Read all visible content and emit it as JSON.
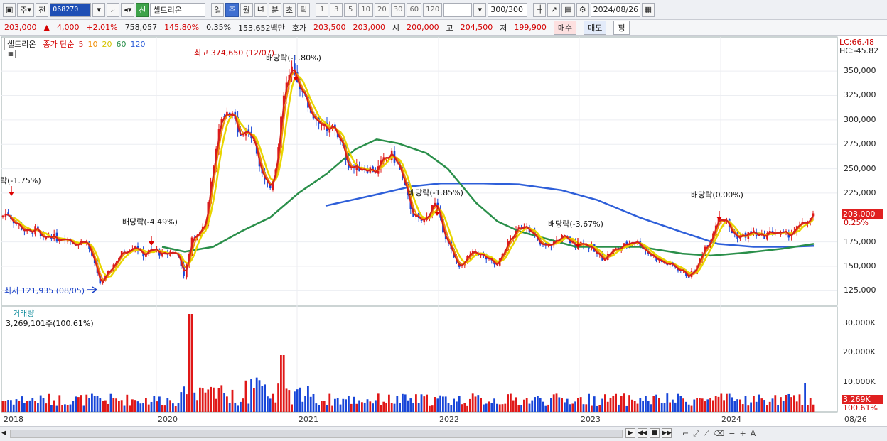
{
  "toolbar": {
    "period_type": "주",
    "prev_label": "전",
    "stock_code": "068270",
    "badge": "신",
    "stock_name": "셀트리온",
    "periods": [
      "일",
      "주",
      "월",
      "년",
      "분",
      "초",
      "틱"
    ],
    "selected_period": "주",
    "counts": [
      "1",
      "3",
      "5",
      "10",
      "20",
      "30",
      "60",
      "120"
    ],
    "view_count": "300",
    "view_total": "/300",
    "date": "2024/08/26"
  },
  "quote": {
    "price": "203,000",
    "change_arrow": "▲",
    "change": "4,000",
    "change_pct": "+2.01%",
    "volume": "758,057",
    "vol_ratio": "145.80%",
    "turnover": "0.35%",
    "amount": "153,652백만",
    "bid_label": "호가",
    "ask": "203,500",
    "bid": "203,000",
    "open_label": "시",
    "open": "200,000",
    "high_label": "고",
    "high": "204,500",
    "low_label": "저",
    "low": "199,900",
    "buy": "매수",
    "sell": "매도",
    "avg": "평"
  },
  "legend": {
    "stock": "셀트리온",
    "type": "종가 단순",
    "ma": [
      {
        "label": "5",
        "color": "#d42020"
      },
      {
        "label": "10",
        "color": "#f0900a"
      },
      {
        "label": "20",
        "color": "#e8d600"
      },
      {
        "label": "60",
        "color": "#2a8f4a"
      },
      {
        "label": "120",
        "color": "#2e5fd9"
      }
    ]
  },
  "annotations": {
    "high": "최고 374,650 (12/07)",
    "low": "최저 121,935 (08/05)",
    "div1": "락(-1.75%)",
    "div2": "배당락(-4.49%)",
    "div3": "배당락(-1.80%)",
    "div4": "배당락(-1.85%)",
    "div5": "배당락(-3.67%)",
    "div6": "배당락(0.00%)"
  },
  "right_info": {
    "lc": "LC:66.48",
    "hc": "HC:-45.82",
    "price_box": "203,000",
    "pct": "0.25%",
    "vol_box": "3,269K",
    "vol_pct": "100.61%"
  },
  "price_axis": [
    "350,000",
    "325,000",
    "300,000",
    "275,000",
    "250,000",
    "225,000",
    "175,000",
    "150,000",
    "125,000"
  ],
  "volume": {
    "label": "거래량",
    "value": "3,269,101주(100.61%)",
    "axis": [
      "30,000K",
      "20,000K",
      "10,000K"
    ]
  },
  "years": [
    "2018",
    "2020",
    "2021",
    "2022",
    "2023",
    "2024"
  ],
  "last_date": "08/26",
  "chart_data": {
    "type": "candlestick-weekly",
    "ylim": [
      110000,
      385000
    ],
    "close_path": [
      [
        0,
        200000
      ],
      [
        10,
        205000
      ],
      [
        20,
        196000
      ],
      [
        30,
        190000
      ],
      [
        40,
        184000
      ],
      [
        50,
        188000
      ],
      [
        60,
        176000
      ],
      [
        70,
        183000
      ],
      [
        80,
        178000
      ],
      [
        90,
        181000
      ],
      [
        100,
        176000
      ],
      [
        110,
        173000
      ],
      [
        120,
        178000
      ],
      [
        130,
        160000
      ],
      [
        140,
        132000
      ],
      [
        150,
        140000
      ],
      [
        160,
        152000
      ],
      [
        170,
        162000
      ],
      [
        180,
        168000
      ],
      [
        190,
        172000
      ],
      [
        200,
        162000
      ],
      [
        210,
        165000
      ],
      [
        220,
        167000
      ],
      [
        230,
        160000
      ],
      [
        240,
        165000
      ],
      [
        250,
        163000
      ],
      [
        260,
        140000
      ],
      [
        270,
        178000
      ],
      [
        280,
        185000
      ],
      [
        290,
        196000
      ],
      [
        300,
        255000
      ],
      [
        310,
        296000
      ],
      [
        320,
        305000
      ],
      [
        330,
        300000
      ],
      [
        340,
        285000
      ],
      [
        350,
        290000
      ],
      [
        360,
        270000
      ],
      [
        370,
        245000
      ],
      [
        380,
        230000
      ],
      [
        390,
        260000
      ],
      [
        400,
        330000
      ],
      [
        410,
        350000
      ],
      [
        420,
        340000
      ],
      [
        430,
        320000
      ],
      [
        440,
        305000
      ],
      [
        450,
        300000
      ],
      [
        460,
        285000
      ],
      [
        470,
        295000
      ],
      [
        480,
        275000
      ],
      [
        490,
        255000
      ],
      [
        500,
        250000
      ],
      [
        510,
        252000
      ],
      [
        520,
        250000
      ],
      [
        530,
        248000
      ],
      [
        540,
        258000
      ],
      [
        550,
        265000
      ],
      [
        560,
        255000
      ],
      [
        570,
        230000
      ],
      [
        580,
        205000
      ],
      [
        590,
        196000
      ],
      [
        600,
        198000
      ],
      [
        610,
        218000
      ],
      [
        620,
        195000
      ],
      [
        630,
        175000
      ],
      [
        640,
        155000
      ],
      [
        650,
        150000
      ],
      [
        660,
        160000
      ],
      [
        670,
        165000
      ],
      [
        680,
        160000
      ],
      [
        690,
        155000
      ],
      [
        700,
        150000
      ],
      [
        710,
        168000
      ],
      [
        720,
        180000
      ],
      [
        730,
        188000
      ],
      [
        740,
        195000
      ],
      [
        750,
        182000
      ],
      [
        760,
        172000
      ],
      [
        770,
        170000
      ],
      [
        780,
        175000
      ],
      [
        790,
        180000
      ],
      [
        800,
        176000
      ],
      [
        810,
        172000
      ],
      [
        820,
        175000
      ],
      [
        830,
        170000
      ],
      [
        840,
        162000
      ],
      [
        850,
        158000
      ],
      [
        860,
        165000
      ],
      [
        870,
        168000
      ],
      [
        880,
        172000
      ],
      [
        890,
        176000
      ],
      [
        900,
        174000
      ],
      [
        910,
        165000
      ],
      [
        920,
        160000
      ],
      [
        930,
        155000
      ],
      [
        940,
        152000
      ],
      [
        950,
        150000
      ],
      [
        960,
        145000
      ],
      [
        970,
        140000
      ],
      [
        980,
        148000
      ],
      [
        990,
        168000
      ],
      [
        1000,
        178000
      ],
      [
        1010,
        200000
      ],
      [
        1020,
        198000
      ],
      [
        1030,
        185000
      ],
      [
        1040,
        180000
      ],
      [
        1050,
        182000
      ],
      [
        1060,
        185000
      ],
      [
        1070,
        180000
      ],
      [
        1080,
        183000
      ],
      [
        1090,
        186000
      ],
      [
        1100,
        182000
      ],
      [
        1110,
        183000
      ],
      [
        1120,
        188000
      ],
      [
        1130,
        193000
      ],
      [
        1140,
        199000
      ],
      [
        1145,
        203000
      ]
    ],
    "ma120_points": [
      [
        458,
        212000
      ],
      [
        520,
        222000
      ],
      [
        580,
        232000
      ],
      [
        620,
        235000
      ],
      [
        680,
        235000
      ],
      [
        730,
        234000
      ],
      [
        790,
        228000
      ],
      [
        840,
        218000
      ],
      [
        900,
        200000
      ],
      [
        960,
        185000
      ],
      [
        1010,
        173000
      ],
      [
        1060,
        170000
      ],
      [
        1110,
        170000
      ],
      [
        1145,
        171000
      ]
    ],
    "ma60_points": [
      [
        228,
        170000
      ],
      [
        260,
        165000
      ],
      [
        300,
        170000
      ],
      [
        340,
        186000
      ],
      [
        380,
        200000
      ],
      [
        420,
        225000
      ],
      [
        460,
        245000
      ],
      [
        500,
        270000
      ],
      [
        530,
        280000
      ],
      [
        560,
        276000
      ],
      [
        600,
        266000
      ],
      [
        630,
        250000
      ],
      [
        670,
        215000
      ],
      [
        700,
        196000
      ],
      [
        730,
        186000
      ],
      [
        770,
        178000
      ],
      [
        810,
        170000
      ],
      [
        850,
        170000
      ],
      [
        900,
        170000
      ],
      [
        960,
        163000
      ],
      [
        1000,
        161000
      ],
      [
        1050,
        164000
      ],
      [
        1100,
        168000
      ],
      [
        1145,
        173000
      ]
    ]
  }
}
